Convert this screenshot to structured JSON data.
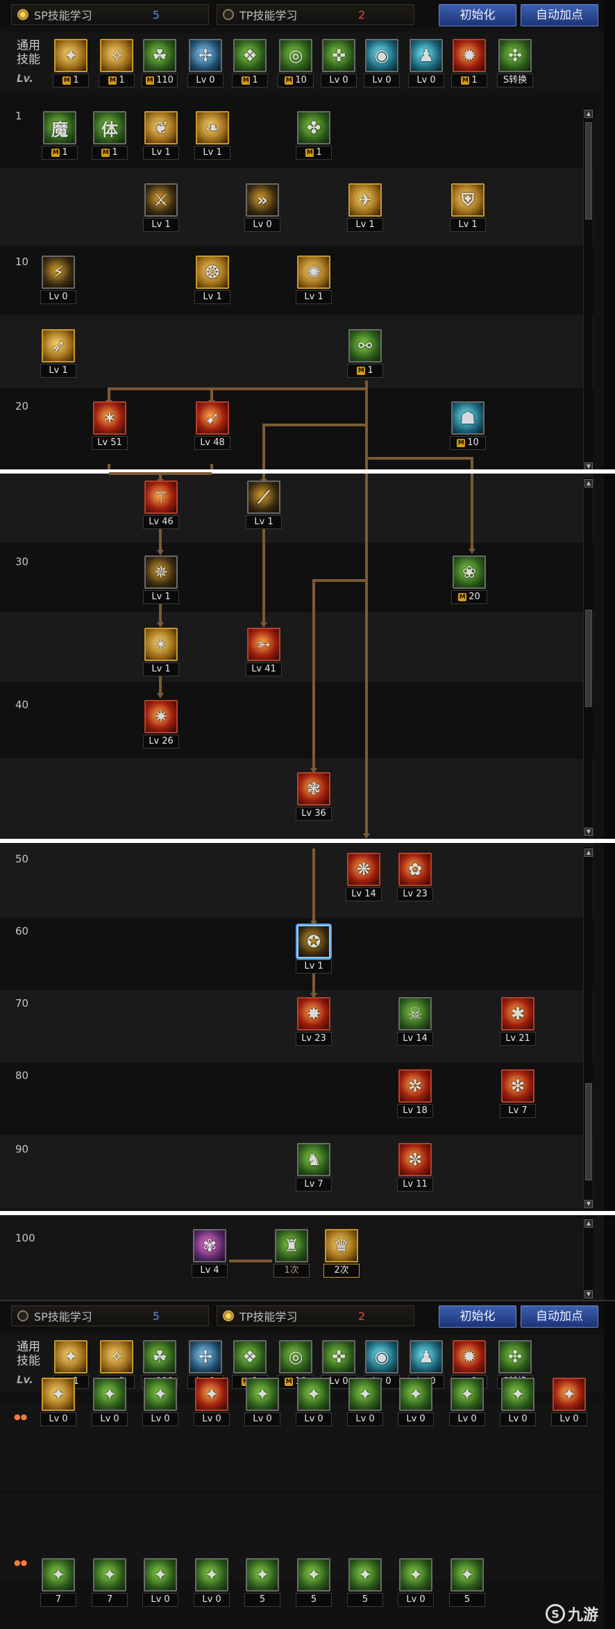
{
  "top": {
    "sp_tab_label": "SP技能学习",
    "sp_points": "5",
    "tp_tab_label": "TP技能学习",
    "tp_points": "2",
    "reset_label": "初始化",
    "auto_label": "自动加点",
    "general_label": "通用技能",
    "lv_label": "Lv."
  },
  "general_skills": [
    {
      "cap": "1",
      "m": true,
      "color": "gold",
      "glyph": "✦"
    },
    {
      "cap": "1",
      "m": true,
      "color": "gold",
      "glyph": "✧"
    },
    {
      "cap": "110",
      "m": true,
      "color": "green",
      "glyph": "☘"
    },
    {
      "cap": "Lv 0",
      "m": false,
      "color": "blue",
      "glyph": "✢"
    },
    {
      "cap": "1",
      "m": true,
      "color": "green",
      "glyph": "❖"
    },
    {
      "cap": "10",
      "m": true,
      "color": "green",
      "glyph": "◎"
    },
    {
      "cap": "Lv 0",
      "m": false,
      "color": "green",
      "glyph": "✜"
    },
    {
      "cap": "Lv 0",
      "m": false,
      "color": "teal",
      "glyph": "◉"
    },
    {
      "cap": "Lv 0",
      "m": false,
      "color": "teal",
      "glyph": "♟"
    },
    {
      "cap": "1",
      "m": true,
      "color": "red",
      "glyph": "✹"
    },
    {
      "cap": "S转换",
      "m": false,
      "color": "green",
      "glyph": "✣"
    }
  ],
  "levels": {
    "l1": "1",
    "l10": "10",
    "l20": "20",
    "l30": "30",
    "l40": "40",
    "l50": "50",
    "l60": "60",
    "l70": "70",
    "l80": "80",
    "l90": "90",
    "l100": "100"
  },
  "tree": [
    {
      "id": "s1",
      "cap": "1",
      "m": true,
      "color": "green",
      "glyph": "魔"
    },
    {
      "id": "s2",
      "cap": "1",
      "m": true,
      "color": "green",
      "glyph": "体"
    },
    {
      "id": "s3",
      "cap": "Lv 1",
      "m": false,
      "color": "gold",
      "glyph": "❦"
    },
    {
      "id": "s4",
      "cap": "Lv 1",
      "m": false,
      "color": "gold",
      "glyph": "❧"
    },
    {
      "id": "s5",
      "cap": "1",
      "m": true,
      "color": "green",
      "glyph": "✤"
    },
    {
      "id": "s6",
      "cap": "Lv 1",
      "m": false,
      "color": "dark",
      "glyph": "⚔"
    },
    {
      "id": "s7",
      "cap": "Lv 0",
      "m": false,
      "color": "dark",
      "glyph": "»"
    },
    {
      "id": "s8",
      "cap": "Lv 1",
      "m": false,
      "color": "gold",
      "glyph": "✈"
    },
    {
      "id": "s9",
      "cap": "Lv 1",
      "m": false,
      "color": "gold",
      "glyph": "⛨"
    },
    {
      "id": "s10",
      "cap": "Lv 0",
      "m": false,
      "color": "dark",
      "glyph": "⚡"
    },
    {
      "id": "s11",
      "cap": "Lv 1",
      "m": false,
      "color": "gold",
      "glyph": "❂"
    },
    {
      "id": "s12",
      "cap": "Lv 1",
      "m": false,
      "color": "gold",
      "glyph": "✺"
    },
    {
      "id": "s13",
      "cap": "Lv 1",
      "m": false,
      "color": "gold",
      "glyph": "➶"
    },
    {
      "id": "s14",
      "cap": "1",
      "m": true,
      "color": "green",
      "glyph": "⚯"
    },
    {
      "id": "s15",
      "cap": "Lv 51",
      "m": false,
      "color": "red",
      "glyph": "✶"
    },
    {
      "id": "s16",
      "cap": "Lv 48",
      "m": false,
      "color": "red",
      "glyph": "➹"
    },
    {
      "id": "s17",
      "cap": "10",
      "m": true,
      "color": "teal",
      "glyph": "☗"
    },
    {
      "id": "s18",
      "cap": "Lv 46",
      "m": false,
      "color": "red",
      "glyph": "⚚"
    },
    {
      "id": "s19",
      "cap": "Lv 1",
      "m": false,
      "color": "dark",
      "glyph": "⟋"
    },
    {
      "id": "s20",
      "cap": "Lv 1",
      "m": false,
      "color": "dark",
      "glyph": "✵"
    },
    {
      "id": "s21",
      "cap": "20",
      "m": true,
      "color": "green",
      "glyph": "❀"
    },
    {
      "id": "s22",
      "cap": "Lv 1",
      "m": false,
      "color": "gold",
      "glyph": "✴"
    },
    {
      "id": "s23",
      "cap": "Lv 41",
      "m": false,
      "color": "red",
      "glyph": "➳"
    },
    {
      "id": "s24",
      "cap": "Lv 26",
      "m": false,
      "color": "red",
      "glyph": "✷"
    },
    {
      "id": "s25",
      "cap": "Lv 36",
      "m": false,
      "color": "red",
      "glyph": "❃"
    },
    {
      "id": "s26",
      "cap": "Lv 14",
      "m": false,
      "color": "red",
      "glyph": "❋"
    },
    {
      "id": "s27",
      "cap": "Lv 23",
      "m": false,
      "color": "red",
      "glyph": "✿"
    },
    {
      "id": "s28",
      "cap": "Lv 1",
      "m": false,
      "color": "dark",
      "glyph": "✪"
    },
    {
      "id": "s29",
      "cap": "Lv 23",
      "m": false,
      "color": "red",
      "glyph": "✸"
    },
    {
      "id": "s30",
      "cap": "Lv 14",
      "m": false,
      "color": "green",
      "glyph": "☠"
    },
    {
      "id": "s31",
      "cap": "Lv 21",
      "m": false,
      "color": "red",
      "glyph": "✱"
    },
    {
      "id": "s32",
      "cap": "Lv 18",
      "m": false,
      "color": "red",
      "glyph": "✲"
    },
    {
      "id": "s33",
      "cap": "Lv 7",
      "m": false,
      "color": "red",
      "glyph": "✻"
    },
    {
      "id": "s34",
      "cap": "Lv 7",
      "m": false,
      "color": "green",
      "glyph": "♞"
    },
    {
      "id": "s35",
      "cap": "Lv 11",
      "m": false,
      "color": "red",
      "glyph": "✼"
    },
    {
      "id": "s36",
      "cap": "Lv 4",
      "m": false,
      "color": "pink",
      "glyph": "✾"
    }
  ],
  "awaken": [
    {
      "cap": "1次",
      "color": "green",
      "glyph": "♜"
    },
    {
      "cap": "2次",
      "color": "gold",
      "glyph": "♛"
    }
  ],
  "tp_rows": [
    [
      {
        "cap": "Lv 0",
        "color": "gold"
      },
      {
        "cap": "Lv 0",
        "color": "green"
      },
      {
        "cap": "Lv 0",
        "color": "green"
      },
      {
        "cap": "Lv 0",
        "color": "red"
      },
      {
        "cap": "Lv 0",
        "color": "green"
      },
      {
        "cap": "Lv 0",
        "color": "green"
      },
      {
        "cap": "Lv 0",
        "color": "green"
      },
      {
        "cap": "Lv 0",
        "color": "green"
      },
      {
        "cap": "Lv 0",
        "color": "green"
      },
      {
        "cap": "Lv 0",
        "color": "green"
      },
      {
        "cap": "Lv 0",
        "color": "red"
      }
    ],
    [
      {
        "cap": "7",
        "color": "green"
      },
      {
        "cap": "7",
        "color": "green"
      },
      {
        "cap": "Lv 0",
        "color": "green"
      },
      {
        "cap": "Lv 0",
        "color": "green"
      },
      {
        "cap": "5",
        "color": "green"
      },
      {
        "cap": "5",
        "color": "green"
      },
      {
        "cap": "5",
        "color": "green"
      },
      {
        "cap": "Lv 0",
        "color": "green"
      },
      {
        "cap": "5",
        "color": "green"
      }
    ]
  ],
  "watermark": "九游"
}
